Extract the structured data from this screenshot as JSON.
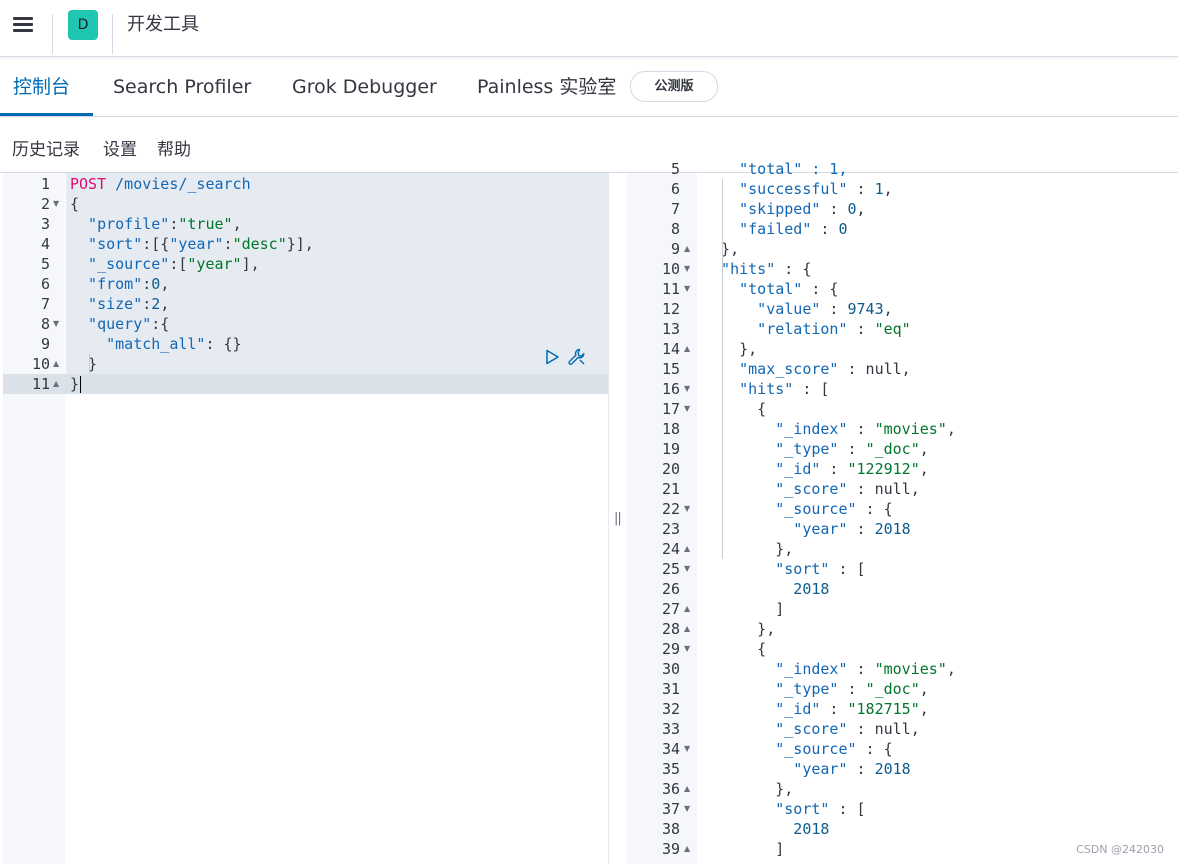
{
  "header": {
    "space_initial": "D",
    "title": "开发工具"
  },
  "tabs": [
    {
      "label": "控制台",
      "active": true
    },
    {
      "label": "Search Profiler",
      "active": false
    },
    {
      "label": "Grok Debugger",
      "active": false
    },
    {
      "label": "Painless 实验室",
      "active": false
    }
  ],
  "beta_badge": "公测版",
  "top_nav": [
    "历史记录",
    "设置",
    "帮助"
  ],
  "request_lines": [
    {
      "n": "1",
      "fold": "",
      "tokens": [
        {
          "t": "POST",
          "c": "c-meth"
        },
        {
          "t": " /movies/_search",
          "c": "c-path"
        }
      ]
    },
    {
      "n": "2",
      "fold": "down",
      "tokens": [
        {
          "t": "{",
          "c": "c-pun"
        }
      ]
    },
    {
      "n": "3",
      "fold": "",
      "tokens": [
        {
          "t": "  \"profile\"",
          "c": "c-key"
        },
        {
          "t": ":",
          "c": "c-pun"
        },
        {
          "t": "\"true\"",
          "c": "c-str"
        },
        {
          "t": ",",
          "c": "c-pun"
        }
      ]
    },
    {
      "n": "4",
      "fold": "",
      "tokens": [
        {
          "t": "  \"sort\"",
          "c": "c-key"
        },
        {
          "t": ":[{",
          "c": "c-pun"
        },
        {
          "t": "\"year\"",
          "c": "c-key"
        },
        {
          "t": ":",
          "c": "c-pun"
        },
        {
          "t": "\"desc\"",
          "c": "c-str"
        },
        {
          "t": "}],",
          "c": "c-pun"
        }
      ]
    },
    {
      "n": "5",
      "fold": "",
      "tokens": [
        {
          "t": "  \"_source\"",
          "c": "c-key"
        },
        {
          "t": ":[",
          "c": "c-pun"
        },
        {
          "t": "\"year\"",
          "c": "c-str"
        },
        {
          "t": "],",
          "c": "c-pun"
        }
      ]
    },
    {
      "n": "6",
      "fold": "",
      "tokens": [
        {
          "t": "  \"from\"",
          "c": "c-key"
        },
        {
          "t": ":",
          "c": "c-pun"
        },
        {
          "t": "0",
          "c": "c-num"
        },
        {
          "t": ",",
          "c": "c-pun"
        }
      ]
    },
    {
      "n": "7",
      "fold": "",
      "tokens": [
        {
          "t": "  \"size\"",
          "c": "c-key"
        },
        {
          "t": ":",
          "c": "c-pun"
        },
        {
          "t": "2",
          "c": "c-num"
        },
        {
          "t": ",",
          "c": "c-pun"
        }
      ]
    },
    {
      "n": "8",
      "fold": "down",
      "tokens": [
        {
          "t": "  \"query\"",
          "c": "c-key"
        },
        {
          "t": ":{",
          "c": "c-pun"
        }
      ]
    },
    {
      "n": "9",
      "fold": "",
      "tokens": [
        {
          "t": "    \"match_all\"",
          "c": "c-key"
        },
        {
          "t": ": {}",
          "c": "c-pun"
        }
      ]
    },
    {
      "n": "10",
      "fold": "up",
      "tokens": [
        {
          "t": "  }",
          "c": "c-pun"
        }
      ]
    },
    {
      "n": "11",
      "fold": "up",
      "tokens": [
        {
          "t": "}",
          "c": "c-pun"
        }
      ]
    }
  ],
  "response_lines": [
    {
      "n": "5",
      "fold": "",
      "tokens": [
        {
          "t": "    \"total\" : 1,",
          "c": "c-key"
        }
      ]
    },
    {
      "n": "6",
      "fold": "",
      "tokens": [
        {
          "t": "    \"successful\"",
          "c": "c-key"
        },
        {
          "t": " : ",
          "c": "c-pun"
        },
        {
          "t": "1",
          "c": "c-num"
        },
        {
          "t": ",",
          "c": "c-pun"
        }
      ]
    },
    {
      "n": "7",
      "fold": "",
      "tokens": [
        {
          "t": "    \"skipped\"",
          "c": "c-key"
        },
        {
          "t": " : ",
          "c": "c-pun"
        },
        {
          "t": "0",
          "c": "c-num"
        },
        {
          "t": ",",
          "c": "c-pun"
        }
      ]
    },
    {
      "n": "8",
      "fold": "",
      "tokens": [
        {
          "t": "    \"failed\"",
          "c": "c-key"
        },
        {
          "t": " : ",
          "c": "c-pun"
        },
        {
          "t": "0",
          "c": "c-num"
        }
      ]
    },
    {
      "n": "9",
      "fold": "up",
      "tokens": [
        {
          "t": "  },",
          "c": "c-pun"
        }
      ]
    },
    {
      "n": "10",
      "fold": "down",
      "tokens": [
        {
          "t": "  \"hits\"",
          "c": "c-key"
        },
        {
          "t": " : {",
          "c": "c-pun"
        }
      ]
    },
    {
      "n": "11",
      "fold": "down",
      "tokens": [
        {
          "t": "    \"total\"",
          "c": "c-key"
        },
        {
          "t": " : {",
          "c": "c-pun"
        }
      ]
    },
    {
      "n": "12",
      "fold": "",
      "tokens": [
        {
          "t": "      \"value\"",
          "c": "c-key"
        },
        {
          "t": " : ",
          "c": "c-pun"
        },
        {
          "t": "9743",
          "c": "c-num"
        },
        {
          "t": ",",
          "c": "c-pun"
        }
      ]
    },
    {
      "n": "13",
      "fold": "",
      "tokens": [
        {
          "t": "      \"relation\"",
          "c": "c-key"
        },
        {
          "t": " : ",
          "c": "c-pun"
        },
        {
          "t": "\"eq\"",
          "c": "c-str"
        }
      ]
    },
    {
      "n": "14",
      "fold": "up",
      "tokens": [
        {
          "t": "    },",
          "c": "c-pun"
        }
      ]
    },
    {
      "n": "15",
      "fold": "",
      "tokens": [
        {
          "t": "    \"max_score\"",
          "c": "c-key"
        },
        {
          "t": " : null,",
          "c": "c-pun"
        }
      ]
    },
    {
      "n": "16",
      "fold": "down",
      "tokens": [
        {
          "t": "    \"hits\"",
          "c": "c-key"
        },
        {
          "t": " : [",
          "c": "c-pun"
        }
      ]
    },
    {
      "n": "17",
      "fold": "down",
      "tokens": [
        {
          "t": "      {",
          "c": "c-pun"
        }
      ]
    },
    {
      "n": "18",
      "fold": "",
      "tokens": [
        {
          "t": "        \"_index\"",
          "c": "c-key"
        },
        {
          "t": " : ",
          "c": "c-pun"
        },
        {
          "t": "\"movies\"",
          "c": "c-str"
        },
        {
          "t": ",",
          "c": "c-pun"
        }
      ]
    },
    {
      "n": "19",
      "fold": "",
      "tokens": [
        {
          "t": "        \"_type\"",
          "c": "c-key"
        },
        {
          "t": " : ",
          "c": "c-pun"
        },
        {
          "t": "\"_doc\"",
          "c": "c-str"
        },
        {
          "t": ",",
          "c": "c-pun"
        }
      ]
    },
    {
      "n": "20",
      "fold": "",
      "tokens": [
        {
          "t": "        \"_id\"",
          "c": "c-key"
        },
        {
          "t": " : ",
          "c": "c-pun"
        },
        {
          "t": "\"122912\"",
          "c": "c-str"
        },
        {
          "t": ",",
          "c": "c-pun"
        }
      ]
    },
    {
      "n": "21",
      "fold": "",
      "tokens": [
        {
          "t": "        \"_score\"",
          "c": "c-key"
        },
        {
          "t": " : null,",
          "c": "c-pun"
        }
      ]
    },
    {
      "n": "22",
      "fold": "down",
      "tokens": [
        {
          "t": "        \"_source\"",
          "c": "c-key"
        },
        {
          "t": " : {",
          "c": "c-pun"
        }
      ]
    },
    {
      "n": "23",
      "fold": "",
      "tokens": [
        {
          "t": "          \"year\"",
          "c": "c-key"
        },
        {
          "t": " : ",
          "c": "c-pun"
        },
        {
          "t": "2018",
          "c": "c-num"
        }
      ]
    },
    {
      "n": "24",
      "fold": "up",
      "tokens": [
        {
          "t": "        },",
          "c": "c-pun"
        }
      ]
    },
    {
      "n": "25",
      "fold": "down",
      "tokens": [
        {
          "t": "        \"sort\"",
          "c": "c-key"
        },
        {
          "t": " : [",
          "c": "c-pun"
        }
      ]
    },
    {
      "n": "26",
      "fold": "",
      "tokens": [
        {
          "t": "          2018",
          "c": "c-num"
        }
      ]
    },
    {
      "n": "27",
      "fold": "up",
      "tokens": [
        {
          "t": "        ]",
          "c": "c-pun"
        }
      ]
    },
    {
      "n": "28",
      "fold": "up",
      "tokens": [
        {
          "t": "      },",
          "c": "c-pun"
        }
      ]
    },
    {
      "n": "29",
      "fold": "down",
      "tokens": [
        {
          "t": "      {",
          "c": "c-pun"
        }
      ]
    },
    {
      "n": "30",
      "fold": "",
      "tokens": [
        {
          "t": "        \"_index\"",
          "c": "c-key"
        },
        {
          "t": " : ",
          "c": "c-pun"
        },
        {
          "t": "\"movies\"",
          "c": "c-str"
        },
        {
          "t": ",",
          "c": "c-pun"
        }
      ]
    },
    {
      "n": "31",
      "fold": "",
      "tokens": [
        {
          "t": "        \"_type\"",
          "c": "c-key"
        },
        {
          "t": " : ",
          "c": "c-pun"
        },
        {
          "t": "\"_doc\"",
          "c": "c-str"
        },
        {
          "t": ",",
          "c": "c-pun"
        }
      ]
    },
    {
      "n": "32",
      "fold": "",
      "tokens": [
        {
          "t": "        \"_id\"",
          "c": "c-key"
        },
        {
          "t": " : ",
          "c": "c-pun"
        },
        {
          "t": "\"182715\"",
          "c": "c-str"
        },
        {
          "t": ",",
          "c": "c-pun"
        }
      ]
    },
    {
      "n": "33",
      "fold": "",
      "tokens": [
        {
          "t": "        \"_score\"",
          "c": "c-key"
        },
        {
          "t": " : null,",
          "c": "c-pun"
        }
      ]
    },
    {
      "n": "34",
      "fold": "down",
      "tokens": [
        {
          "t": "        \"_source\"",
          "c": "c-key"
        },
        {
          "t": " : {",
          "c": "c-pun"
        }
      ]
    },
    {
      "n": "35",
      "fold": "",
      "tokens": [
        {
          "t": "          \"year\"",
          "c": "c-key"
        },
        {
          "t": " : ",
          "c": "c-pun"
        },
        {
          "t": "2018",
          "c": "c-num"
        }
      ]
    },
    {
      "n": "36",
      "fold": "up",
      "tokens": [
        {
          "t": "        },",
          "c": "c-pun"
        }
      ]
    },
    {
      "n": "37",
      "fold": "down",
      "tokens": [
        {
          "t": "        \"sort\"",
          "c": "c-key"
        },
        {
          "t": " : [",
          "c": "c-pun"
        }
      ]
    },
    {
      "n": "38",
      "fold": "",
      "tokens": [
        {
          "t": "          2018",
          "c": "c-num"
        }
      ]
    },
    {
      "n": "39",
      "fold": "up",
      "tokens": [
        {
          "t": "        ]",
          "c": "c-pun"
        }
      ]
    }
  ],
  "divider_glyph": "||",
  "watermark": "CSDN @242030",
  "colors": {
    "accent": "#006bb4",
    "space_avatar": "#1fc7b3",
    "string": "#00752c",
    "key": "#1367b4",
    "method": "#dd0a73"
  }
}
